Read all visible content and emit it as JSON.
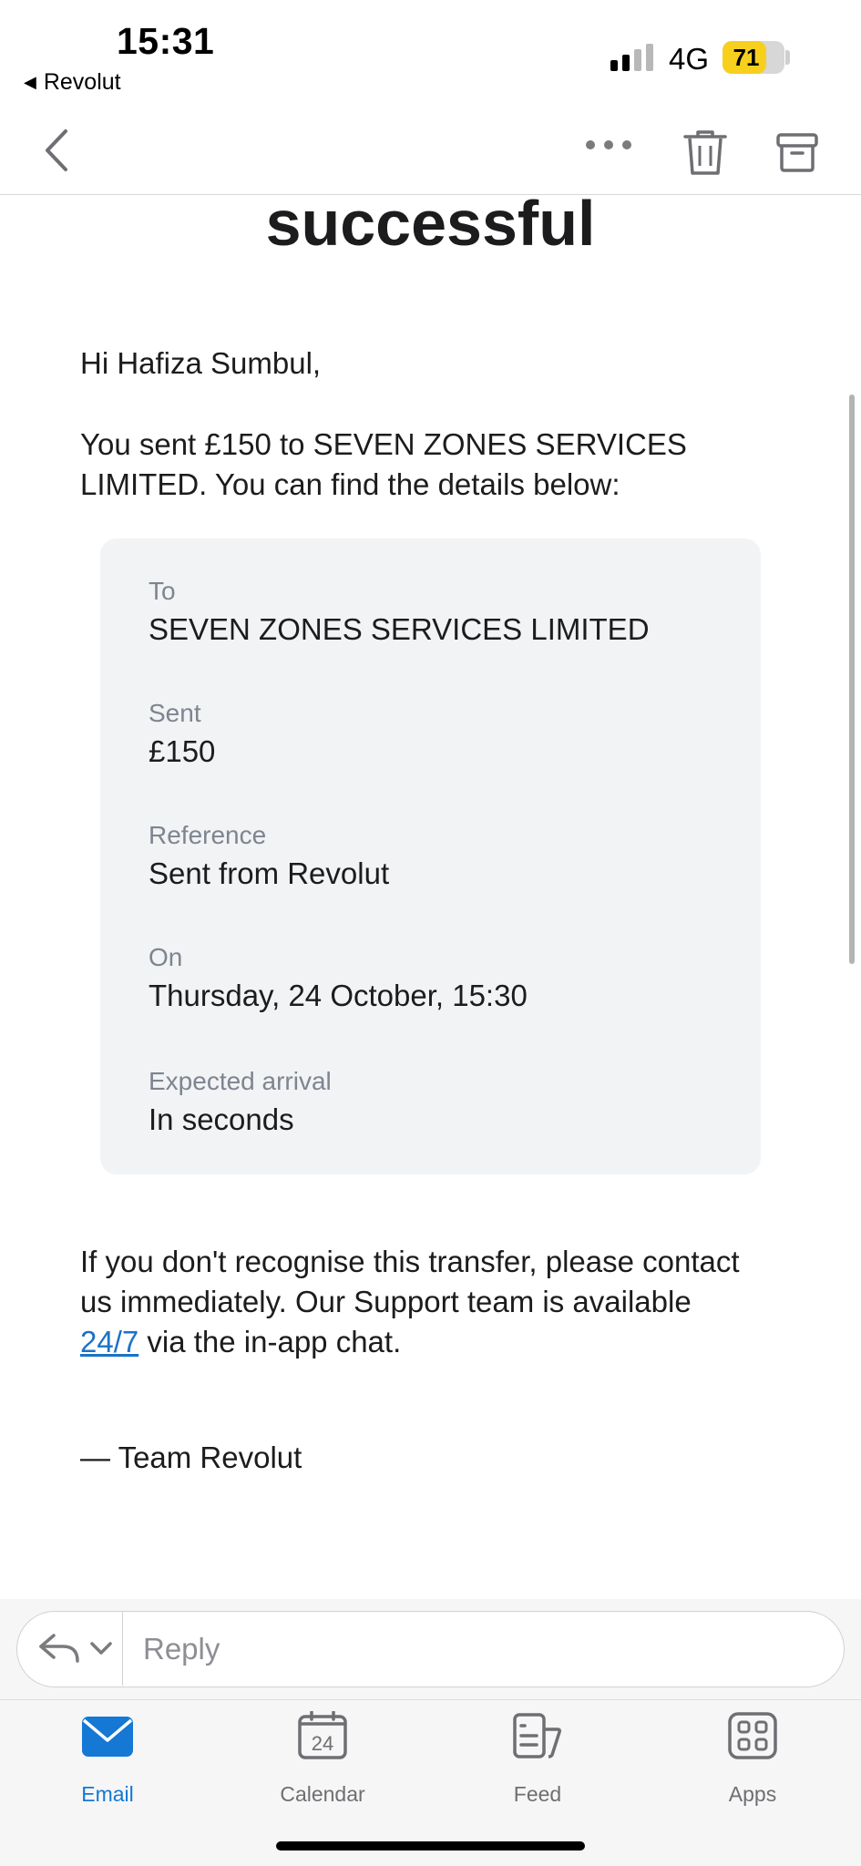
{
  "status_bar": {
    "time": "15:31",
    "back_app": "Revolut",
    "network": "4G",
    "battery_level": "71"
  },
  "email": {
    "headline": "successful",
    "greeting": "Hi Hafiza Sumbul,",
    "intro": "You sent £150 to SEVEN ZONES SERVICES LIMITED. You can find the details below:",
    "details": [
      {
        "label": "To",
        "value": "SEVEN ZONES SERVICES LIMITED"
      },
      {
        "label": "Sent",
        "value": "£150"
      },
      {
        "label": "Reference",
        "value": "Sent from Revolut"
      },
      {
        "label": "On",
        "value": "Thursday, 24 October, 15:30"
      },
      {
        "label": "Expected arrival",
        "value": "In seconds"
      }
    ],
    "closing_pre": "If you don't recognise this transfer, please contact us immediately. Our Support team is available ",
    "closing_link": "24/7",
    "closing_post": " via the in-app chat.",
    "signature": "— Team Revolut"
  },
  "reply": {
    "placeholder": "Reply"
  },
  "tabs": [
    {
      "label": "Email",
      "icon": "mail-icon"
    },
    {
      "label": "Calendar",
      "icon": "calendar-icon",
      "badge": "24"
    },
    {
      "label": "Feed",
      "icon": "feed-icon"
    },
    {
      "label": "Apps",
      "icon": "apps-grid-icon"
    }
  ],
  "colors": {
    "accent": "#1478d4",
    "link": "#1a73c8",
    "battery": "#f7cf1d",
    "card_bg": "#f2f3f5"
  }
}
